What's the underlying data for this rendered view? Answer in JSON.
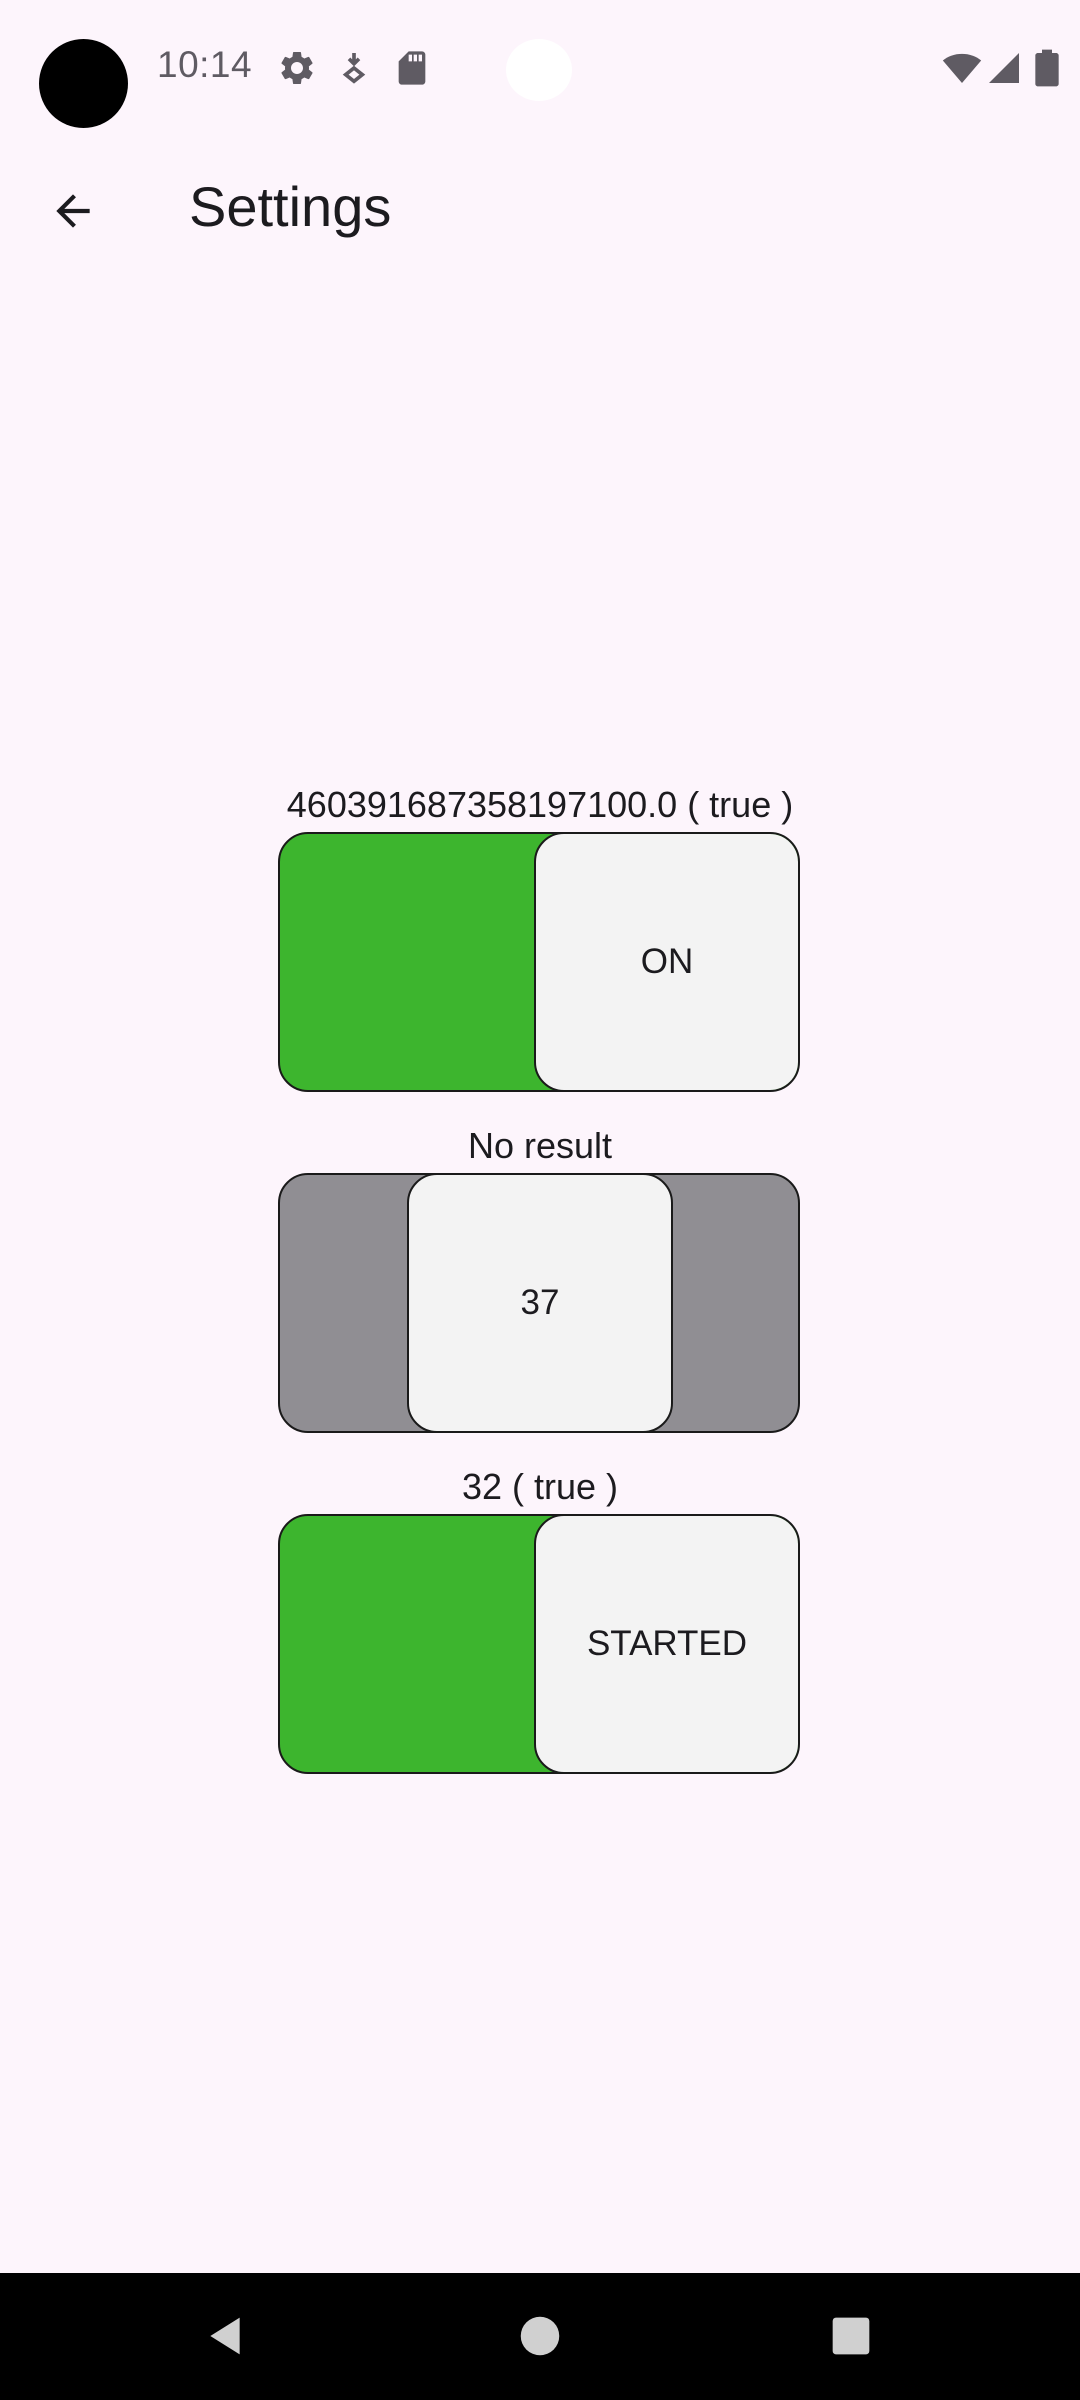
{
  "status_bar": {
    "time": "10:14",
    "icons": [
      "gear-icon",
      "download-icon",
      "sd-card-icon",
      "wifi-icon",
      "signal-icon",
      "battery-icon"
    ]
  },
  "app_bar": {
    "title": "Settings",
    "back_icon": "arrow-left-icon"
  },
  "switches": [
    {
      "label": "460391687358197100.0 ( true )",
      "thumb_text": "ON",
      "state": "on",
      "track_color": "#3db52e"
    },
    {
      "label": "No result",
      "thumb_text": "37",
      "state": "indeterminate",
      "track_color": "#908e93"
    },
    {
      "label": "32 ( true )",
      "thumb_text": "STARTED",
      "state": "on",
      "track_color": "#3db52e"
    }
  ],
  "nav_bar": {
    "buttons": [
      "back-triangle-icon",
      "home-circle-icon",
      "recents-square-icon"
    ]
  }
}
